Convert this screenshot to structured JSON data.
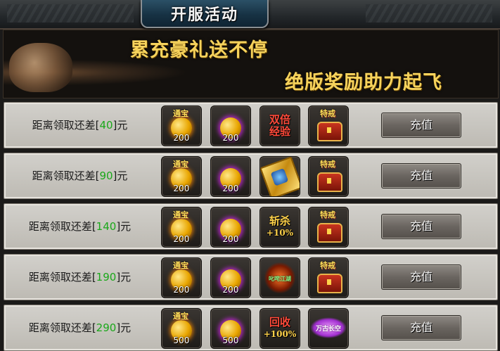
{
  "header": {
    "title": "开服活动"
  },
  "banner": {
    "line1": "累充豪礼送不停",
    "line2": "绝版奖励助力起飞"
  },
  "rows": [
    {
      "prefix": "距离领取还差[",
      "amount": "40",
      "suffix": "]元",
      "button": "充值",
      "items": [
        {
          "kind": "coin",
          "tag": "通宝",
          "qty": "200",
          "icon": "gold-coin-icon"
        },
        {
          "kind": "coin-purple",
          "qty": "200",
          "icon": "purple-coin-icon"
        },
        {
          "kind": "text",
          "line1": "双倍",
          "line2": "经验",
          "icon": "double-exp-icon"
        },
        {
          "kind": "chest",
          "tag": "特戒",
          "icon": "ring-chest-icon"
        }
      ]
    },
    {
      "prefix": "距离领取还差[",
      "amount": "90",
      "suffix": "]元",
      "button": "充值",
      "items": [
        {
          "kind": "coin",
          "tag": "通宝",
          "qty": "200",
          "icon": "gold-coin-icon"
        },
        {
          "kind": "coin-purple",
          "qty": "200",
          "icon": "purple-coin-icon"
        },
        {
          "kind": "book",
          "icon": "skill-book-icon"
        },
        {
          "kind": "chest",
          "tag": "特戒",
          "icon": "ring-chest-icon"
        }
      ]
    },
    {
      "prefix": "距离领取还差[",
      "amount": "140",
      "suffix": "]元",
      "button": "充值",
      "items": [
        {
          "kind": "coin",
          "tag": "通宝",
          "qty": "200",
          "icon": "gold-coin-icon"
        },
        {
          "kind": "coin-purple",
          "qty": "200",
          "icon": "purple-coin-icon"
        },
        {
          "kind": "text",
          "line1": "斩杀",
          "line2": "+10%",
          "icon": "kill-bonus-icon"
        },
        {
          "kind": "chest",
          "tag": "特戒",
          "icon": "ring-chest-icon"
        }
      ]
    },
    {
      "prefix": "距离领取还差[",
      "amount": "190",
      "suffix": "]元",
      "button": "充值",
      "items": [
        {
          "kind": "coin",
          "tag": "通宝",
          "qty": "200",
          "icon": "gold-coin-icon"
        },
        {
          "kind": "coin-purple",
          "qty": "200",
          "icon": "purple-coin-icon"
        },
        {
          "kind": "fire",
          "label": "叱咤江湖",
          "icon": "title-badge-icon"
        },
        {
          "kind": "chest",
          "tag": "特戒",
          "icon": "ring-chest-icon"
        }
      ]
    },
    {
      "prefix": "距离领取还差[",
      "amount": "290",
      "suffix": "]元",
      "button": "充值",
      "items": [
        {
          "kind": "coin",
          "tag": "通宝",
          "qty": "500",
          "icon": "gold-coin-icon"
        },
        {
          "kind": "coin-purple",
          "qty": "500",
          "icon": "purple-coin-icon"
        },
        {
          "kind": "text",
          "line1": "回收",
          "line2": "+100%",
          "icon": "recycle-bonus-icon"
        },
        {
          "kind": "wing",
          "label": "万古长空",
          "icon": "wings-title-icon"
        }
      ]
    }
  ]
}
